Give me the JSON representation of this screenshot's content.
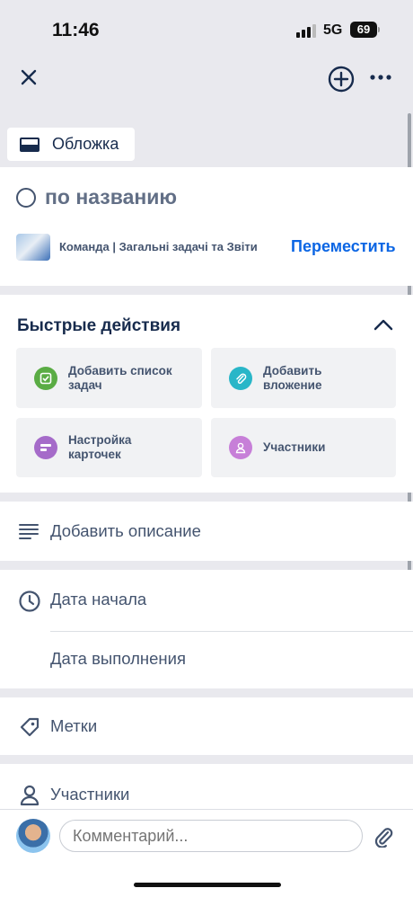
{
  "status_bar": {
    "time": "11:46",
    "network": "5G",
    "battery": "69"
  },
  "toolbar": {
    "close_icon": "close-icon",
    "add_icon": "plus-circle-icon",
    "more_icon": "more-icon"
  },
  "cover": {
    "label": "Обложка"
  },
  "card": {
    "title": "по названию"
  },
  "board": {
    "label": "Команда | Загальні задачі та Звіти",
    "move_label": "Переместить"
  },
  "quick_actions": {
    "title": "Быстрые действия",
    "tiles": [
      {
        "label": "Добавить список\nзадач",
        "color": "#5aac44"
      },
      {
        "label": "Добавить\nвложение",
        "color": "#29b6c8"
      },
      {
        "label": "Настройка\nкарточек",
        "color": "#a56bc9"
      },
      {
        "label": "Участники",
        "color": "#c77fd8"
      }
    ]
  },
  "rows": {
    "description": "Добавить описание",
    "start_date": "Дата начала",
    "due_date": "Дата выполнения",
    "labels": "Метки",
    "members": "Участники"
  },
  "comment": {
    "placeholder": "Комментарий..."
  },
  "colors": {
    "accent": "#0c66e4",
    "text": "#172b4d",
    "muted": "#44546f"
  }
}
